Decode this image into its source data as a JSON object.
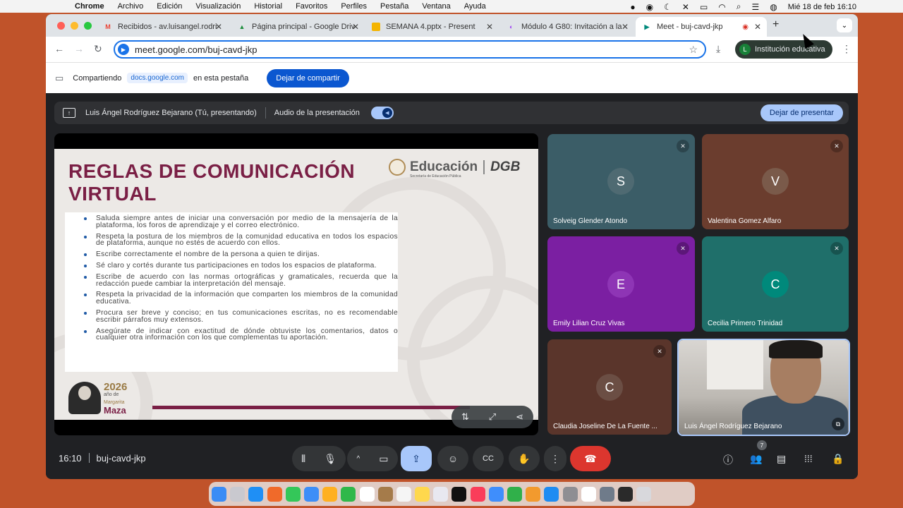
{
  "menubar": {
    "app": "Chrome",
    "menus": [
      "Archivo",
      "Edición",
      "Visualización",
      "Historial",
      "Favoritos",
      "Perfiles",
      "Pestaña",
      "Ventana",
      "Ayuda"
    ],
    "clock": "Mié 18 de feb  16:10"
  },
  "tabs": [
    {
      "title": "Recibidos - av.luisangel.rodri",
      "icon": "gmail-icon",
      "color": "#ea4335"
    },
    {
      "title": "Página principal - Google Driv",
      "icon": "drive-icon",
      "color": "#1e8e3e"
    },
    {
      "title": "SEMANA 4.pptx - Present",
      "icon": "slides-icon",
      "color": "#f4b400"
    },
    {
      "title": "Módulo 4 G80: Invitación a la",
      "icon": "classroom-icon",
      "color": "#a142f4"
    },
    {
      "title": "Meet - buj-cavd-jkp",
      "icon": "meet-icon",
      "color": "#00897b"
    }
  ],
  "omnibox": {
    "url": "meet.google.com/buj-cavd-jkp"
  },
  "profile": {
    "initial": "L",
    "name": "Institución educativa"
  },
  "sharebar": {
    "label": "Compartiendo",
    "domain": "docs.google.com",
    "suffix": "en esta pestaña",
    "stop": "Dejar de compartir"
  },
  "presentbar": {
    "presenter": "Luis Ángel Rodríguez Bejarano (Tú, presentando)",
    "audio": "Audio de la presentación",
    "stop": "Dejar de presentar"
  },
  "slide": {
    "title": "REGLAS DE COMUNICACIÓN VIRTUAL",
    "logo_word": "Educación",
    "logo_sub": "Secretaría de Educación Pública",
    "logo_dgb": "DGB",
    "year_text": "2026",
    "year_small": "año de",
    "year_name1": "Margarita",
    "year_name2": "Maza",
    "rules": [
      "Saluda siempre antes de iniciar una conversación por medio de la mensajería de la plataforma, los foros de aprendizaje y el correo electrónico.",
      "Respeta la postura de los miembros de la comunidad educativa en todos los espacios de plataforma, aunque no estés de acuerdo con ellos.",
      "Escribe correctamente el nombre de la persona a quien te dirijas.",
      "Sé claro y cortés durante tus participaciones en todos los espacios de plataforma.",
      "Escribe de acuerdo con las normas ortográficas y gramaticales, recuerda que la redacción puede cambiar la interpretación del mensaje.",
      "Respeta la privacidad de la información que comparten los miembros de la comunidad educativa.",
      "Procura ser breve y conciso; en tus comunicaciones escritas, no es recomendable escribir párrafos muy extensos.",
      "Asegúrate de indicar con exactitud de dónde obtuviste los comentarios, datos o cualquier otra información con los que complementas tu aportación."
    ]
  },
  "participants": [
    {
      "initial": "S",
      "name": "Solveig Glender Atondo",
      "bg": "#3b5d67",
      "avatar": "#4f6a72"
    },
    {
      "initial": "V",
      "name": "Valentina Gomez Alfaro",
      "bg": "#6b3d2e",
      "avatar": "#7a5a4a"
    },
    {
      "initial": "E",
      "name": "Emily Lilian Cruz Vivas",
      "bg": "#7b1fa2",
      "avatar": "#8e35b5"
    },
    {
      "initial": "C",
      "name": "Cecilia Primero Trinidad",
      "bg": "#1f6f6a",
      "avatar": "#00897b"
    },
    {
      "initial": "C",
      "name": "Claudia Joseline De La Fuente ...",
      "bg": "#5a352b",
      "avatar": "#6b4e44"
    }
  ],
  "self": {
    "name": "Luis Ángel Rodríguez Bejarano"
  },
  "bottombar": {
    "time": "16:10",
    "code": "buj-cavd-jkp",
    "people_count": "7"
  }
}
